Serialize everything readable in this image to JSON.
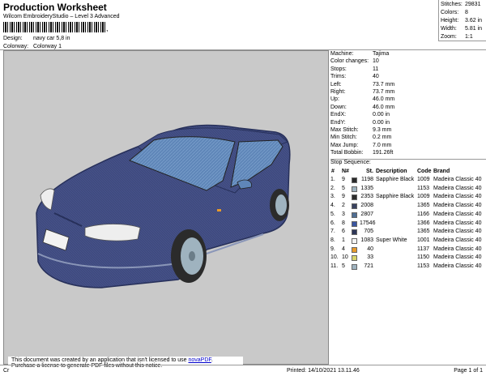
{
  "header": {
    "title": "Production Worksheet",
    "subtitle": "Wilcom EmbroideryStudio – Level 3 Advanced",
    "barcode_suffix": ",",
    "design_label": "Design:",
    "design_value": "navy car 5,8 in",
    "colorway_label": "Colorway:",
    "colorway_value": "Colorway 1"
  },
  "summary": [
    {
      "k": "Stitches:",
      "v": "29831"
    },
    {
      "k": "Colors:",
      "v": "8"
    },
    {
      "k": "Height:",
      "v": "3.62 in"
    },
    {
      "k": "Width:",
      "v": "5.81 in"
    },
    {
      "k": "Zoom:",
      "v": "1:1"
    }
  ],
  "info": [
    {
      "k": "Machine:",
      "v": "Tajima"
    },
    {
      "k": "Color changes:",
      "v": "10"
    },
    {
      "k": "Stops:",
      "v": "11"
    },
    {
      "k": "Trims:",
      "v": "40"
    },
    {
      "k": "Left:",
      "v": "73.7 mm"
    },
    {
      "k": "Right:",
      "v": "73.7 mm"
    },
    {
      "k": "Up:",
      "v": "46.0 mm"
    },
    {
      "k": "Down:",
      "v": "46.0 mm"
    },
    {
      "k": "EndX:",
      "v": "0.00 in"
    },
    {
      "k": "EndY:",
      "v": "0.00 in"
    },
    {
      "k": "Max Stitch:",
      "v": "9.3 mm"
    },
    {
      "k": "Min Stitch:",
      "v": "0.2 mm"
    },
    {
      "k": "Max Jump:",
      "v": "7.0 mm"
    },
    {
      "k": "Total Bobbin:",
      "v": "191.26ft"
    }
  ],
  "sequence": {
    "title": "Stop Sequence:",
    "headers": {
      "num": "#",
      "needle": "N#",
      "st": "St.",
      "desc": "Description",
      "code": "Code",
      "brand": "Brand"
    },
    "rows": [
      {
        "num": "1.",
        "needle": "9",
        "color": "#2b2b2b",
        "st": "1198",
        "desc": "Sapphire Black",
        "code": "1009",
        "brand": "Madeira Classic 40"
      },
      {
        "num": "2.",
        "needle": "5",
        "color": "#9fb3bf",
        "st": "1335",
        "desc": "",
        "code": "1153",
        "brand": "Madeira Classic 40"
      },
      {
        "num": "3.",
        "needle": "9",
        "color": "#2b2b2b",
        "st": "2353",
        "desc": "Sapphire Black",
        "code": "1009",
        "brand": "Madeira Classic 40"
      },
      {
        "num": "4.",
        "needle": "2",
        "color": "#39425f",
        "st": "2008",
        "desc": "",
        "code": "1365",
        "brand": "Madeira Classic 40"
      },
      {
        "num": "5.",
        "needle": "3",
        "color": "#4f6e93",
        "st": "2807",
        "desc": "",
        "code": "1166",
        "brand": "Madeira Classic 40"
      },
      {
        "num": "6.",
        "needle": "8",
        "color": "#3a56a0",
        "st": "17546",
        "desc": "",
        "code": "1366",
        "brand": "Madeira Classic 40"
      },
      {
        "num": "7.",
        "needle": "6",
        "color": "#2e3658",
        "st": "705",
        "desc": "",
        "code": "1365",
        "brand": "Madeira Classic 40"
      },
      {
        "num": "8.",
        "needle": "1",
        "color": "#f4f4f4",
        "st": "1083",
        "desc": "Super White",
        "code": "1001",
        "brand": "Madeira Classic 40"
      },
      {
        "num": "9.",
        "needle": "4",
        "color": "#e89a2a",
        "st": "40",
        "desc": "",
        "code": "1137",
        "brand": "Madeira Classic 40"
      },
      {
        "num": "10.",
        "needle": "10",
        "color": "#d8d46a",
        "st": "33",
        "desc": "",
        "code": "1150",
        "brand": "Madeira Classic 40"
      },
      {
        "num": "11.",
        "needle": "5",
        "color": "#9fb3bf",
        "st": "721",
        "desc": "",
        "code": "1153",
        "brand": "Madeira Classic 40"
      }
    ]
  },
  "notice": {
    "text1": "This document was created by an application that isn't licensed to use ",
    "link": "novaPDF",
    "text1_end": ".",
    "text2": "Purchase a license to generate PDF files without this notice."
  },
  "footer": {
    "left": "Cr",
    "printed": "Printed: 14/10/2021 13.11.46",
    "page": "Page 1 of 1"
  },
  "colors": {
    "body": "#3f4a7e",
    "window": "#5f86b8",
    "canvas": "#c9c9c9"
  }
}
